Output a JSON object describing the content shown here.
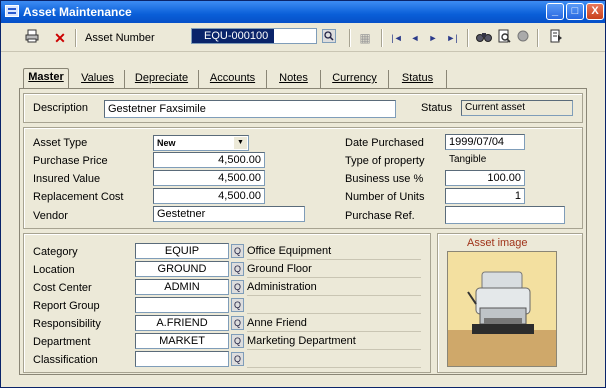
{
  "window": {
    "title": "Asset Maintenance",
    "min": "_",
    "max": "□",
    "close": "X"
  },
  "toolbar": {
    "asset_number_label": "Asset Number",
    "asset_number_value": "EQU-000100",
    "nav_first": "|◄",
    "nav_prev": "◄",
    "nav_next": "►",
    "nav_last": "►|"
  },
  "tabs": [
    {
      "label": "Master"
    },
    {
      "label": "Values"
    },
    {
      "label": "Depreciate"
    },
    {
      "label": "Accounts"
    },
    {
      "label": "Notes"
    },
    {
      "label": "Currency"
    },
    {
      "label": "Status"
    }
  ],
  "header": {
    "description_label": "Description",
    "description_value": "Gestetner Faxsimile",
    "status_label": "Status",
    "status_value": "Current asset"
  },
  "left_fields": {
    "asset_type_label": "Asset Type",
    "asset_type_value": "New",
    "purchase_price_label": "Purchase Price",
    "purchase_price_value": "4,500.00",
    "insured_value_label": "Insured Value",
    "insured_value_value": "4,500.00",
    "replacement_cost_label": "Replacement Cost",
    "replacement_cost_value": "4,500.00",
    "vendor_label": "Vendor",
    "vendor_value": "Gestetner"
  },
  "right_fields": {
    "date_purchased_label": "Date Purchased",
    "date_purchased_value": "1999/07/04",
    "type_of_property_label": "Type of property",
    "type_of_property_value": "Tangible",
    "business_use_label": "Business use %",
    "business_use_value": "100.00",
    "number_of_units_label": "Number of Units",
    "number_of_units_value": "1",
    "purchase_ref_label": "Purchase Ref.",
    "purchase_ref_value": ""
  },
  "classification": [
    {
      "label": "Category",
      "code": "EQUIP",
      "desc": "Office Equipment"
    },
    {
      "label": "Location",
      "code": "GROUND",
      "desc": "Ground Floor"
    },
    {
      "label": "Cost Center",
      "code": "ADMIN",
      "desc": "Administration"
    },
    {
      "label": "Report Group",
      "code": "",
      "desc": ""
    },
    {
      "label": "Responsibility",
      "code": "A.FRIEND",
      "desc": "Anne Friend"
    },
    {
      "label": "Department",
      "code": "MARKET",
      "desc": "Marketing Department"
    },
    {
      "label": "Classification",
      "code": "",
      "desc": ""
    }
  ],
  "asset_image": {
    "label": "Asset image"
  },
  "icons": [
    "app-icon",
    "print-icon",
    "delete-icon",
    "lookup-icon",
    "filter-icon",
    "find-icon",
    "report-icon",
    "record-icon",
    "exit-icon"
  ]
}
